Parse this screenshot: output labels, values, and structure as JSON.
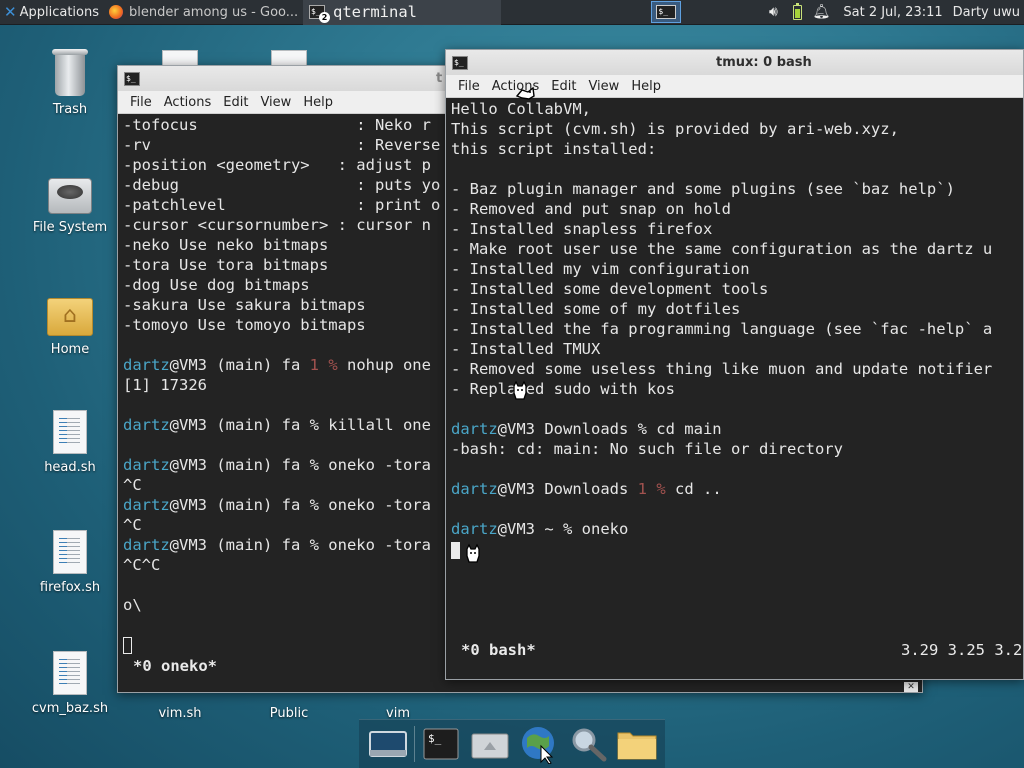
{
  "panel": {
    "apps_label": "Applications",
    "firefox_task": "blender among us - Goo...",
    "terminal_task": "qterminal",
    "terminal_badge": "2",
    "clock": "Sat  2 Jul, 23:11",
    "user": "Darty uwu",
    "icons": [
      "xfce-icon",
      "firefox-icon",
      "terminal-icon",
      "workspace-icon",
      "volume-icon",
      "battery-icon",
      "notification-bell-icon"
    ]
  },
  "desktop": {
    "icons": [
      {
        "label": "Trash",
        "icon": "trash-icon"
      },
      {
        "label": "File System",
        "icon": "drive-icon"
      },
      {
        "label": "Home",
        "icon": "home-folder-icon"
      },
      {
        "label": "head.sh",
        "icon": "script-file-icon"
      },
      {
        "label": "firefox.sh",
        "icon": "script-file-icon"
      },
      {
        "label": "cvm_baz.sh",
        "icon": "script-file-icon"
      },
      {
        "label": "vim.sh",
        "icon": "script-file-icon"
      },
      {
        "label": "Public",
        "icon": "folder-icon"
      },
      {
        "label": "vim",
        "icon": "folder-icon"
      }
    ]
  },
  "menu": [
    "File",
    "Actions",
    "Edit",
    "View",
    "Help"
  ],
  "win_left": {
    "title": "t",
    "lines": [
      [
        {
          "t": "-tofocus                 : Neko r"
        }
      ],
      [
        {
          "t": "-rv                      : Reverse"
        }
      ],
      [
        {
          "t": "-position <geometry>   : adjust p"
        }
      ],
      [
        {
          "t": "-debug                   : puts yo"
        }
      ],
      [
        {
          "t": "-patchlevel              : print o"
        }
      ],
      [
        {
          "t": "-cursor <cursornumber> : cursor n"
        }
      ],
      [
        {
          "t": "-neko Use neko bitmaps"
        }
      ],
      [
        {
          "t": "-tora Use tora bitmaps"
        }
      ],
      [
        {
          "t": "-dog Use dog bitmaps"
        }
      ],
      [
        {
          "t": "-sakura Use sakura bitmaps"
        }
      ],
      [
        {
          "t": "-tomoyo Use tomoyo bitmaps"
        }
      ],
      [
        {
          "t": ""
        }
      ],
      [
        {
          "t": "dartz",
          "c": "u"
        },
        {
          "t": "@VM3 (main) fa "
        },
        {
          "t": "1 %",
          "c": "d"
        },
        {
          "t": " nohup one"
        }
      ],
      [
        {
          "t": "[1] 17326"
        }
      ],
      [
        {
          "t": ""
        }
      ],
      [
        {
          "t": "dartz",
          "c": "u"
        },
        {
          "t": "@VM3 (main) fa % killall one"
        }
      ],
      [
        {
          "t": ""
        }
      ],
      [
        {
          "t": "dartz",
          "c": "u"
        },
        {
          "t": "@VM3 (main) fa % oneko -tora"
        }
      ],
      [
        {
          "t": "^C"
        }
      ],
      [
        {
          "t": "dartz",
          "c": "u"
        },
        {
          "t": "@VM3 (main) fa % oneko -tora"
        }
      ],
      [
        {
          "t": "^C"
        }
      ],
      [
        {
          "t": "dartz",
          "c": "u"
        },
        {
          "t": "@VM3 (main) fa % oneko -tora"
        }
      ],
      [
        {
          "t": "^C^C"
        }
      ],
      [
        {
          "t": ""
        }
      ],
      [
        {
          "t": "o\\"
        }
      ],
      [
        {
          "t": ""
        }
      ]
    ],
    "status": "*0 oneko*"
  },
  "win_right": {
    "title": "tmux: 0 bash",
    "lines": [
      [
        {
          "t": "Hello CollabVM,"
        }
      ],
      [
        {
          "t": "This script (cvm.sh) is provided by ari-web.xyz,"
        }
      ],
      [
        {
          "t": "this script installed:"
        }
      ],
      [
        {
          "t": ""
        }
      ],
      [
        {
          "t": "- Baz plugin manager and some plugins (see `baz help`)"
        }
      ],
      [
        {
          "t": "- Removed and put snap on hold"
        }
      ],
      [
        {
          "t": "- Installed snapless firefox"
        }
      ],
      [
        {
          "t": "- Make root user use the same configuration as the dartz u"
        }
      ],
      [
        {
          "t": "- Installed my vim configuration"
        }
      ],
      [
        {
          "t": "- Installed some development tools"
        }
      ],
      [
        {
          "t": "- Installed some of my dotfiles"
        }
      ],
      [
        {
          "t": "- Installed the fa programming language (see `fac -help` a"
        }
      ],
      [
        {
          "t": "- Installed TMUX"
        }
      ],
      [
        {
          "t": "- Removed some useless thing like muon and update notifier"
        }
      ],
      [
        {
          "t": "- Replaced sudo with kos"
        }
      ],
      [
        {
          "t": ""
        }
      ],
      [
        {
          "t": "dartz",
          "c": "u"
        },
        {
          "t": "@VM3 Downloads % cd main"
        }
      ],
      [
        {
          "t": "-bash: cd: main: No such file or directory"
        }
      ],
      [
        {
          "t": ""
        }
      ],
      [
        {
          "t": "dartz",
          "c": "u"
        },
        {
          "t": "@VM3 Downloads "
        },
        {
          "t": "1 %",
          "c": "d"
        },
        {
          "t": " cd .."
        }
      ],
      [
        {
          "t": ""
        }
      ],
      [
        {
          "t": "dartz",
          "c": "u"
        },
        {
          "t": "@VM3 ~ % oneko"
        }
      ]
    ],
    "status_left": "*0 bash*",
    "status_right": "3.29 3.25 3.2"
  },
  "dock": {
    "items": [
      "show-desktop-icon",
      "terminal-icon",
      "file-manager-icon",
      "web-browser-icon",
      "search-icon",
      "folder-icon"
    ]
  },
  "colors": {
    "prompt_user": "#4aa6c8",
    "exit_code": "#a2524f",
    "terminal_bg": "#232323"
  }
}
